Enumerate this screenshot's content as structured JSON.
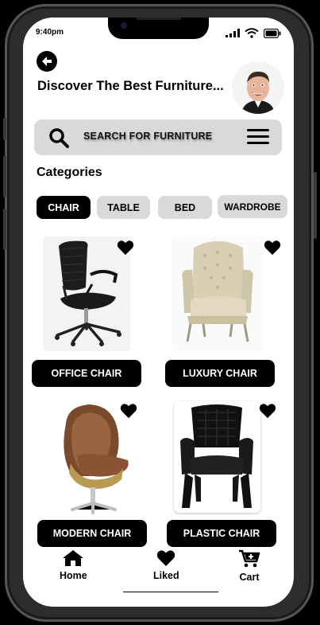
{
  "status_bar": {
    "time": "9:40pm"
  },
  "header": {
    "title": "Discover The Best Furniture..."
  },
  "search": {
    "placeholder": "SEARCH FOR FURNITURE"
  },
  "categories": {
    "heading": "Categories",
    "chips": [
      {
        "label": "CHAIR",
        "active": true
      },
      {
        "label": "TABLE",
        "active": false
      },
      {
        "label": "BED",
        "active": false
      },
      {
        "label": "WARDROBE",
        "active": false
      }
    ]
  },
  "products": [
    {
      "name": "OFFICE CHAIR",
      "liked": true
    },
    {
      "name": "LUXURY CHAIR",
      "liked": true
    },
    {
      "name": "MODERN CHAIR",
      "liked": true
    },
    {
      "name": "PLASTIC CHAIR",
      "liked": true
    }
  ],
  "bottom_nav": {
    "home": "Home",
    "liked": "Liked",
    "cart": "Cart"
  },
  "colors": {
    "accent": "#000000",
    "chip_inactive": "#d9d9d9",
    "search_bg": "#d9d9d9",
    "screen_bg": "#ffffff"
  },
  "icons": [
    "back-arrow-icon",
    "search-icon",
    "menu-icon",
    "heart-icon",
    "home-icon",
    "cart-icon",
    "signal-icon",
    "wifi-icon",
    "battery-icon"
  ]
}
